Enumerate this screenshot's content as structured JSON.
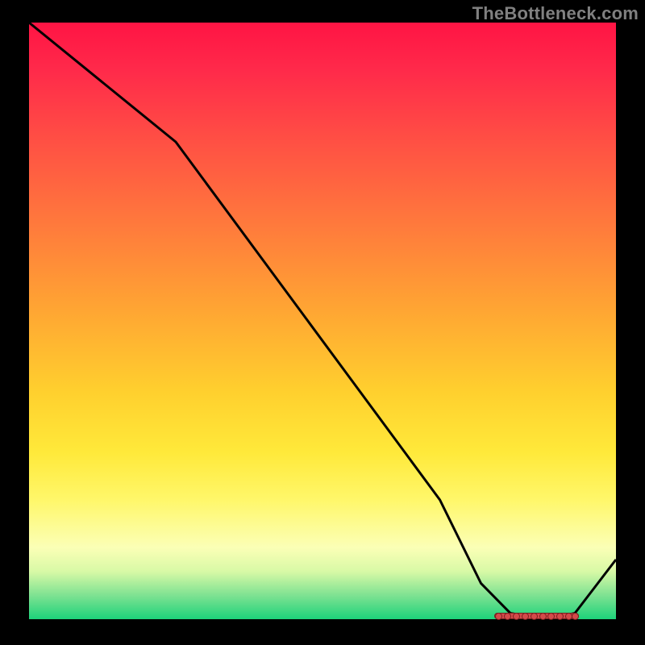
{
  "watermark": "TheBottleneck.com",
  "colors": {
    "curve": "#000000",
    "marker_fill": "#d34a4a",
    "marker_stroke": "#7a1f1f"
  },
  "chart_data": {
    "type": "line",
    "title": "",
    "xlabel": "",
    "ylabel": "",
    "x_range": [
      0,
      100
    ],
    "y_range": [
      0,
      100
    ],
    "ylim": [
      0,
      100
    ],
    "series": [
      {
        "name": "curve",
        "x": [
          0,
          10,
          25,
          40,
          55,
          70,
          77,
          82,
          88,
          93,
          100
        ],
        "y": [
          100,
          92,
          80,
          60,
          40,
          20,
          6,
          1,
          0,
          1,
          10
        ]
      }
    ],
    "marker_band": {
      "start_x": 80,
      "end_x": 93,
      "y": 0.5,
      "points_x": [
        80,
        81.5,
        83,
        84.5,
        86,
        87.5,
        89,
        90.5,
        92,
        93
      ]
    },
    "background_gradient": [
      {
        "stop": 0,
        "color": "#ff1444"
      },
      {
        "stop": 34,
        "color": "#ff7a3c"
      },
      {
        "stop": 62,
        "color": "#ffd02e"
      },
      {
        "stop": 88,
        "color": "#fbffb6"
      },
      {
        "stop": 100,
        "color": "#1dd27a"
      }
    ]
  }
}
